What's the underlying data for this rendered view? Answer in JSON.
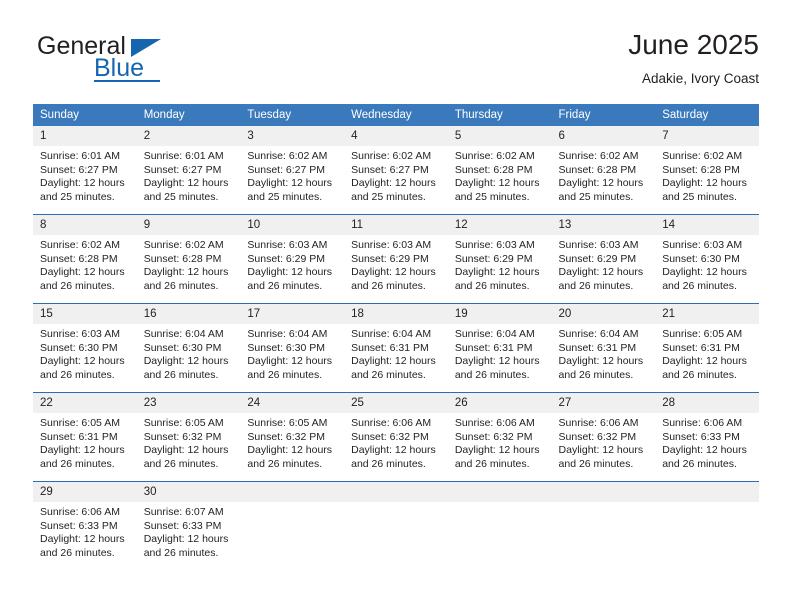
{
  "brand": {
    "name_part1": "General",
    "name_part2": "Blue",
    "accent_color": "#1565b0",
    "triangle_icon": "brand-triangle-icon"
  },
  "header": {
    "title": "June 2025",
    "subtitle": "Adakie, Ivory Coast"
  },
  "theme": {
    "header_bg": "#3b79bd",
    "daynum_bg": "#f0f0f0",
    "week_divider": "#2a6db5",
    "text": "#231f20"
  },
  "weekday_headers": [
    "Sunday",
    "Monday",
    "Tuesday",
    "Wednesday",
    "Thursday",
    "Friday",
    "Saturday"
  ],
  "weeks": [
    [
      {
        "day": "1",
        "sunrise": "Sunrise: 6:01 AM",
        "sunset": "Sunset: 6:27 PM",
        "daylight": "Daylight: 12 hours and 25 minutes."
      },
      {
        "day": "2",
        "sunrise": "Sunrise: 6:01 AM",
        "sunset": "Sunset: 6:27 PM",
        "daylight": "Daylight: 12 hours and 25 minutes."
      },
      {
        "day": "3",
        "sunrise": "Sunrise: 6:02 AM",
        "sunset": "Sunset: 6:27 PM",
        "daylight": "Daylight: 12 hours and 25 minutes."
      },
      {
        "day": "4",
        "sunrise": "Sunrise: 6:02 AM",
        "sunset": "Sunset: 6:27 PM",
        "daylight": "Daylight: 12 hours and 25 minutes."
      },
      {
        "day": "5",
        "sunrise": "Sunrise: 6:02 AM",
        "sunset": "Sunset: 6:28 PM",
        "daylight": "Daylight: 12 hours and 25 minutes."
      },
      {
        "day": "6",
        "sunrise": "Sunrise: 6:02 AM",
        "sunset": "Sunset: 6:28 PM",
        "daylight": "Daylight: 12 hours and 25 minutes."
      },
      {
        "day": "7",
        "sunrise": "Sunrise: 6:02 AM",
        "sunset": "Sunset: 6:28 PM",
        "daylight": "Daylight: 12 hours and 25 minutes."
      }
    ],
    [
      {
        "day": "8",
        "sunrise": "Sunrise: 6:02 AM",
        "sunset": "Sunset: 6:28 PM",
        "daylight": "Daylight: 12 hours and 26 minutes."
      },
      {
        "day": "9",
        "sunrise": "Sunrise: 6:02 AM",
        "sunset": "Sunset: 6:28 PM",
        "daylight": "Daylight: 12 hours and 26 minutes."
      },
      {
        "day": "10",
        "sunrise": "Sunrise: 6:03 AM",
        "sunset": "Sunset: 6:29 PM",
        "daylight": "Daylight: 12 hours and 26 minutes."
      },
      {
        "day": "11",
        "sunrise": "Sunrise: 6:03 AM",
        "sunset": "Sunset: 6:29 PM",
        "daylight": "Daylight: 12 hours and 26 minutes."
      },
      {
        "day": "12",
        "sunrise": "Sunrise: 6:03 AM",
        "sunset": "Sunset: 6:29 PM",
        "daylight": "Daylight: 12 hours and 26 minutes."
      },
      {
        "day": "13",
        "sunrise": "Sunrise: 6:03 AM",
        "sunset": "Sunset: 6:29 PM",
        "daylight": "Daylight: 12 hours and 26 minutes."
      },
      {
        "day": "14",
        "sunrise": "Sunrise: 6:03 AM",
        "sunset": "Sunset: 6:30 PM",
        "daylight": "Daylight: 12 hours and 26 minutes."
      }
    ],
    [
      {
        "day": "15",
        "sunrise": "Sunrise: 6:03 AM",
        "sunset": "Sunset: 6:30 PM",
        "daylight": "Daylight: 12 hours and 26 minutes."
      },
      {
        "day": "16",
        "sunrise": "Sunrise: 6:04 AM",
        "sunset": "Sunset: 6:30 PM",
        "daylight": "Daylight: 12 hours and 26 minutes."
      },
      {
        "day": "17",
        "sunrise": "Sunrise: 6:04 AM",
        "sunset": "Sunset: 6:30 PM",
        "daylight": "Daylight: 12 hours and 26 minutes."
      },
      {
        "day": "18",
        "sunrise": "Sunrise: 6:04 AM",
        "sunset": "Sunset: 6:31 PM",
        "daylight": "Daylight: 12 hours and 26 minutes."
      },
      {
        "day": "19",
        "sunrise": "Sunrise: 6:04 AM",
        "sunset": "Sunset: 6:31 PM",
        "daylight": "Daylight: 12 hours and 26 minutes."
      },
      {
        "day": "20",
        "sunrise": "Sunrise: 6:04 AM",
        "sunset": "Sunset: 6:31 PM",
        "daylight": "Daylight: 12 hours and 26 minutes."
      },
      {
        "day": "21",
        "sunrise": "Sunrise: 6:05 AM",
        "sunset": "Sunset: 6:31 PM",
        "daylight": "Daylight: 12 hours and 26 minutes."
      }
    ],
    [
      {
        "day": "22",
        "sunrise": "Sunrise: 6:05 AM",
        "sunset": "Sunset: 6:31 PM",
        "daylight": "Daylight: 12 hours and 26 minutes."
      },
      {
        "day": "23",
        "sunrise": "Sunrise: 6:05 AM",
        "sunset": "Sunset: 6:32 PM",
        "daylight": "Daylight: 12 hours and 26 minutes."
      },
      {
        "day": "24",
        "sunrise": "Sunrise: 6:05 AM",
        "sunset": "Sunset: 6:32 PM",
        "daylight": "Daylight: 12 hours and 26 minutes."
      },
      {
        "day": "25",
        "sunrise": "Sunrise: 6:06 AM",
        "sunset": "Sunset: 6:32 PM",
        "daylight": "Daylight: 12 hours and 26 minutes."
      },
      {
        "day": "26",
        "sunrise": "Sunrise: 6:06 AM",
        "sunset": "Sunset: 6:32 PM",
        "daylight": "Daylight: 12 hours and 26 minutes."
      },
      {
        "day": "27",
        "sunrise": "Sunrise: 6:06 AM",
        "sunset": "Sunset: 6:32 PM",
        "daylight": "Daylight: 12 hours and 26 minutes."
      },
      {
        "day": "28",
        "sunrise": "Sunrise: 6:06 AM",
        "sunset": "Sunset: 6:33 PM",
        "daylight": "Daylight: 12 hours and 26 minutes."
      }
    ],
    [
      {
        "day": "29",
        "sunrise": "Sunrise: 6:06 AM",
        "sunset": "Sunset: 6:33 PM",
        "daylight": "Daylight: 12 hours and 26 minutes."
      },
      {
        "day": "30",
        "sunrise": "Sunrise: 6:07 AM",
        "sunset": "Sunset: 6:33 PM",
        "daylight": "Daylight: 12 hours and 26 minutes."
      },
      {
        "day": "",
        "sunrise": "",
        "sunset": "",
        "daylight": ""
      },
      {
        "day": "",
        "sunrise": "",
        "sunset": "",
        "daylight": ""
      },
      {
        "day": "",
        "sunrise": "",
        "sunset": "",
        "daylight": ""
      },
      {
        "day": "",
        "sunrise": "",
        "sunset": "",
        "daylight": ""
      },
      {
        "day": "",
        "sunrise": "",
        "sunset": "",
        "daylight": ""
      }
    ]
  ]
}
